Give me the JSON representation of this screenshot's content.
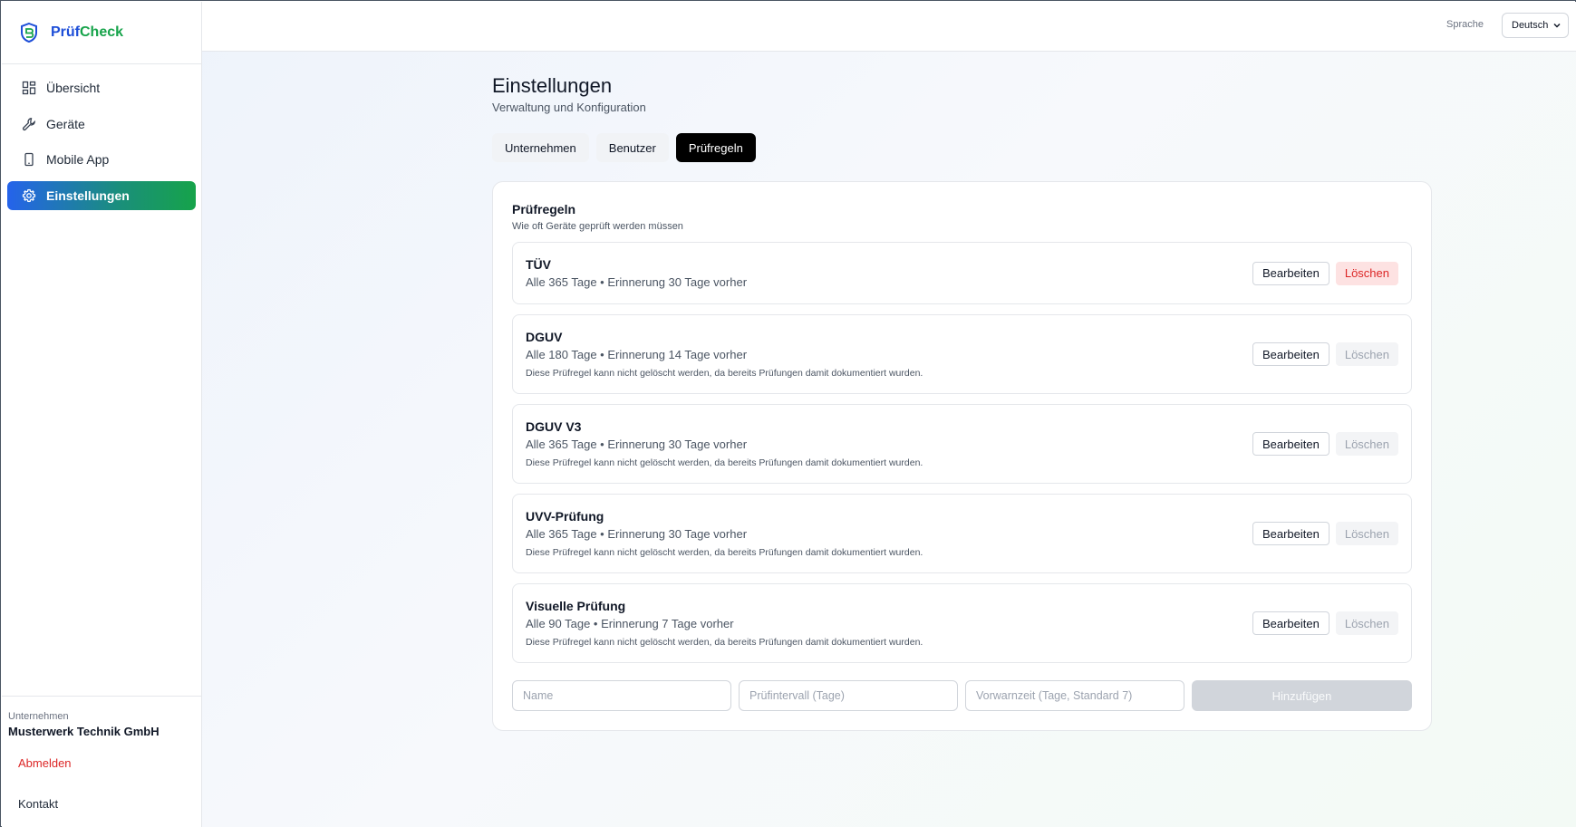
{
  "brand": {
    "name_part1": "Prüf",
    "name_part2": "Check",
    "primary": "#1d4ed8",
    "accent": "#16a34a"
  },
  "sidebar": {
    "items": [
      {
        "label": "Übersicht",
        "icon": "grid-icon"
      },
      {
        "label": "Geräte",
        "icon": "wrench-icon"
      },
      {
        "label": "Mobile App",
        "icon": "smartphone-icon"
      },
      {
        "label": "Einstellungen",
        "icon": "gear-icon",
        "active": true
      }
    ],
    "company_label": "Unternehmen",
    "company_name": "Musterwerk Technik GmbH",
    "logout": "Abmelden",
    "contact": "Kontakt"
  },
  "topbar": {
    "language_label": "Sprache",
    "language_value": "Deutsch"
  },
  "page": {
    "title": "Einstellungen",
    "subtitle": "Verwaltung und Konfiguration",
    "tabs": [
      {
        "label": "Unternehmen"
      },
      {
        "label": "Benutzer"
      },
      {
        "label": "Prüfregeln",
        "active": true
      }
    ]
  },
  "rules_card": {
    "title": "Prüfregeln",
    "subtitle": "Wie oft Geräte geprüft werden müssen",
    "edit_label": "Bearbeiten",
    "delete_label": "Löschen",
    "rules": [
      {
        "name": "TÜV",
        "meta": "Alle 365 Tage • Erinnerung 30 Tage vorher",
        "note": "",
        "deletable": true
      },
      {
        "name": "DGUV",
        "meta": "Alle 180 Tage • Erinnerung 14 Tage vorher",
        "note": "Diese Prüfregel kann nicht gelöscht werden, da bereits Prüfungen damit dokumentiert wurden.",
        "deletable": false
      },
      {
        "name": "DGUV V3",
        "meta": "Alle 365 Tage • Erinnerung 30 Tage vorher",
        "note": "Diese Prüfregel kann nicht gelöscht werden, da bereits Prüfungen damit dokumentiert wurden.",
        "deletable": false
      },
      {
        "name": "UVV-Prüfung",
        "meta": "Alle 365 Tage • Erinnerung 30 Tage vorher",
        "note": "Diese Prüfregel kann nicht gelöscht werden, da bereits Prüfungen damit dokumentiert wurden.",
        "deletable": false
      },
      {
        "name": "Visuelle Prüfung",
        "meta": "Alle 90 Tage • Erinnerung 7 Tage vorher",
        "note": "Diese Prüfregel kann nicht gelöscht werden, da bereits Prüfungen damit dokumentiert wurden.",
        "deletable": false
      }
    ],
    "form": {
      "name_placeholder": "Name",
      "interval_placeholder": "Prüfintervall (Tage)",
      "lead_placeholder": "Vorwarnzeit (Tage, Standard 7)",
      "add_label": "Hinzufügen"
    }
  }
}
